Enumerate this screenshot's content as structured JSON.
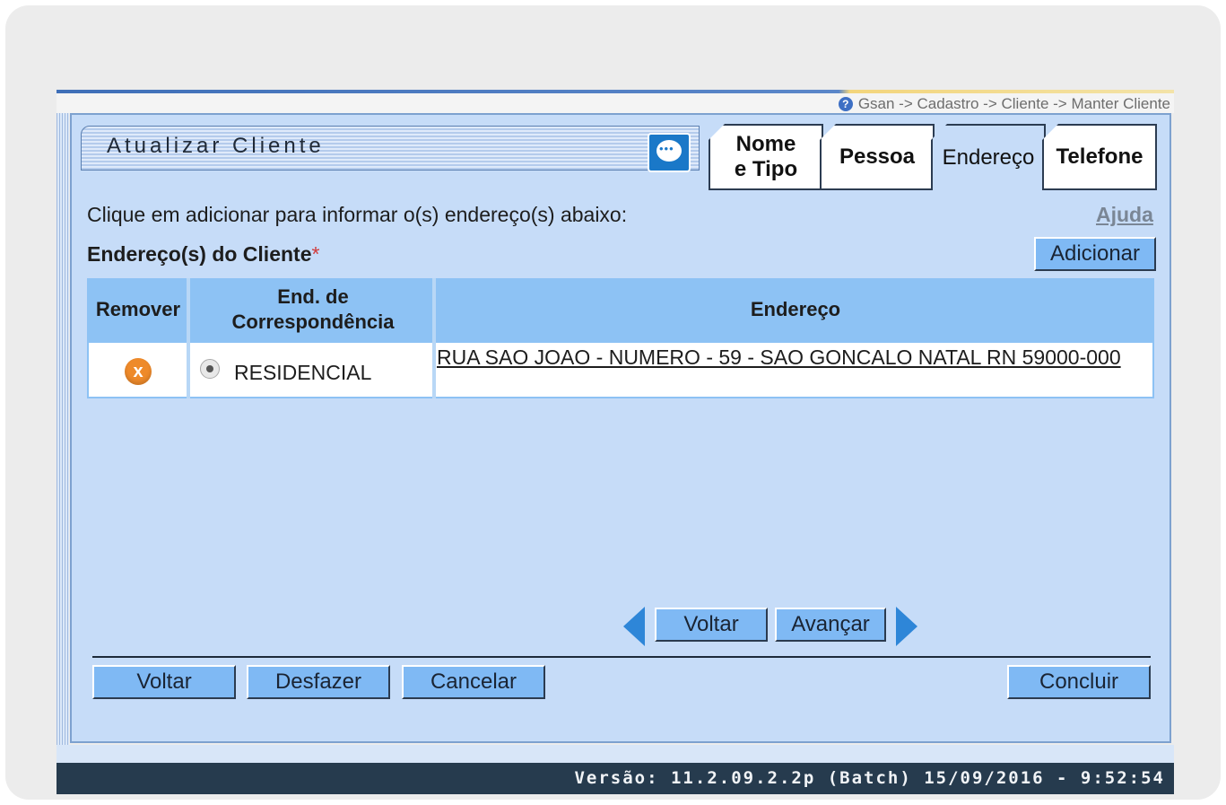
{
  "breadcrumb": "Gsan -> Cadastro -> Cliente -> Manter Cliente",
  "title": "Atualizar Cliente",
  "tabs": [
    {
      "label": "Nome e Tipo",
      "line1": "Nome",
      "line2": "e Tipo"
    },
    {
      "label": "Pessoa"
    },
    {
      "label": "Endereço",
      "active": true
    },
    {
      "label": "Telefone"
    }
  ],
  "instruction": "Clique em adicionar para informar o(s) endereço(s) abaixo:",
  "help_link": "Ajuda",
  "section_label": "Endereço(s) do Cliente",
  "required_mark": "*",
  "add_button": "Adicionar",
  "table": {
    "headers": [
      "Remover",
      "End. de Correspondência",
      "Endereço"
    ],
    "header_corr_line1": "End. de",
    "header_corr_line2": "Correspondência",
    "rows": [
      {
        "remove_icon": "x-circle-icon",
        "type": "RESIDENCIAL",
        "address": "RUA SAO JOAO - NUMERO - 59 - SAO GONCALO NATAL RN 59000-000"
      }
    ]
  },
  "pager": {
    "back": "Voltar",
    "next": "Avançar"
  },
  "buttons": {
    "voltar": "Voltar",
    "desfazer": "Desfazer",
    "cancelar": "Cancelar",
    "concluir": "Concluir"
  },
  "footer": "Versão: 11.2.09.2.2p (Batch) 15/09/2016 - 9:52:54",
  "colors": {
    "panel": "#c6dcf8",
    "button": "#7fb9f4",
    "footer": "#263b4e",
    "remove": "#ee8a2a"
  }
}
